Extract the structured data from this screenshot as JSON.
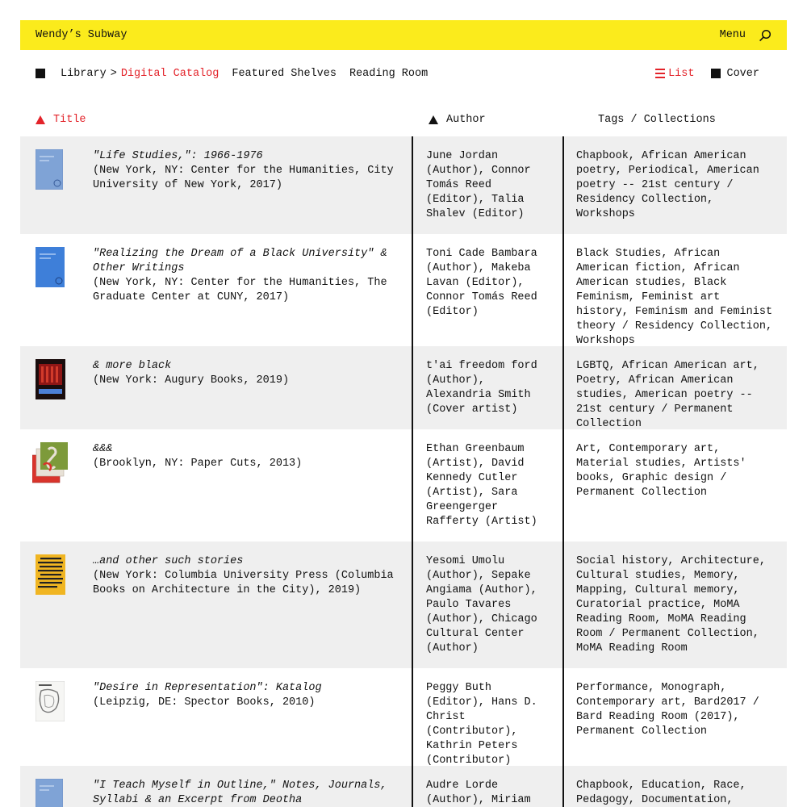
{
  "header": {
    "site_name": "Wendy’s Subway",
    "menu_label": "Menu",
    "search_icon": "search-icon",
    "accent": "#fbeb1c"
  },
  "breadcrumb": {
    "root": "Library",
    "separator": ">",
    "current": "Digital Catalog"
  },
  "nav": {
    "links": [
      "Featured Shelves",
      "Reading Room"
    ]
  },
  "view": {
    "list_label": "List",
    "cover_label": "Cover",
    "active": "List",
    "active_color": "#e3232a"
  },
  "table": {
    "columns": {
      "title": "Title",
      "author": "Author",
      "tags": "Tags / Collections"
    },
    "rows": [
      {
        "title": "\"Life Studies,\": 1966-1976",
        "publication": "(New York, NY: Center for the Humanities, City University of New York, 2017)",
        "authors": "June Jordan (Author), Connor Tomás Reed (Editor), Talia Shalev (Editor)",
        "tags": "Chapbook, African American poetry, Periodical, American poetry -- 21st century / Residency Collection, Workshops"
      },
      {
        "title": "\"Realizing the Dream of a Black University\" & Other Writings",
        "publication": "(New York, NY: Center for the Humanities, The Graduate Center at CUNY, 2017)",
        "authors": "Toni Cade Bambara (Author), Makeba Lavan (Editor), Connor Tomás Reed (Editor)",
        "tags": "Black Studies, African American fiction, African American studies, Black Feminism, Feminist art history, Feminism and Feminist theory / Residency Collection, Workshops"
      },
      {
        "title": "& more black",
        "publication": "(New York: Augury Books, 2019)",
        "authors": "t'ai freedom ford (Author), Alexandria Smith (Cover artist)",
        "tags": "LGBTQ, African American art, Poetry, African American studies, American poetry -- 21st century / Permanent Collection"
      },
      {
        "title": "&&&",
        "publication": "(Brooklyn, NY: Paper Cuts, 2013)",
        "authors": "Ethan Greenbaum (Artist), David Kennedy Cutler (Artist), Sara Greengerger Rafferty (Artist)",
        "tags": "Art, Contemporary art, Material studies, Artists' books, Graphic design / Permanent Collection"
      },
      {
        "title": "…and other such stories",
        "publication": "(New York: Columbia University Press (Columbia Books on Architecture in the City), 2019)",
        "authors": "Yesomi Umolu (Author), Sepake Angiama (Author), Paulo Tavares (Author), Chicago Cultural Center (Author)",
        "tags": "Social history, Architecture, Cultural studies, Memory, Mapping, Cultural memory, Curatorial practice, MoMA Reading Room, MoMA Reading Room / Permanent Collection, MoMA Reading Room"
      },
      {
        "title": "\"Desire in Representation\": Katalog",
        "publication": "(Leipzig, DE: Spector Books, 2010)",
        "authors": "Peggy Buth (Editor), Hans D. Christ (Contributor), Kathrin Peters (Contributor)",
        "tags": "Performance, Monograph, Contemporary art, Bard2017 / Bard Reading Room (2017), Permanent Collection"
      },
      {
        "title": "\"I Teach Myself in Outline,\" Notes, Journals, Syllabi & an Excerpt from Deotha",
        "publication": "",
        "authors": "Audre Lorde (Author), Miriam",
        "tags": "Chapbook, Education, Race, Pedagogy, Documentation, Critical"
      }
    ],
    "cover_icons": [
      "book-cover-icon",
      "book-cover-icon",
      "book-cover-icon",
      "book-cover-icon",
      "book-cover-icon",
      "book-cover-icon",
      "book-cover-icon"
    ]
  }
}
